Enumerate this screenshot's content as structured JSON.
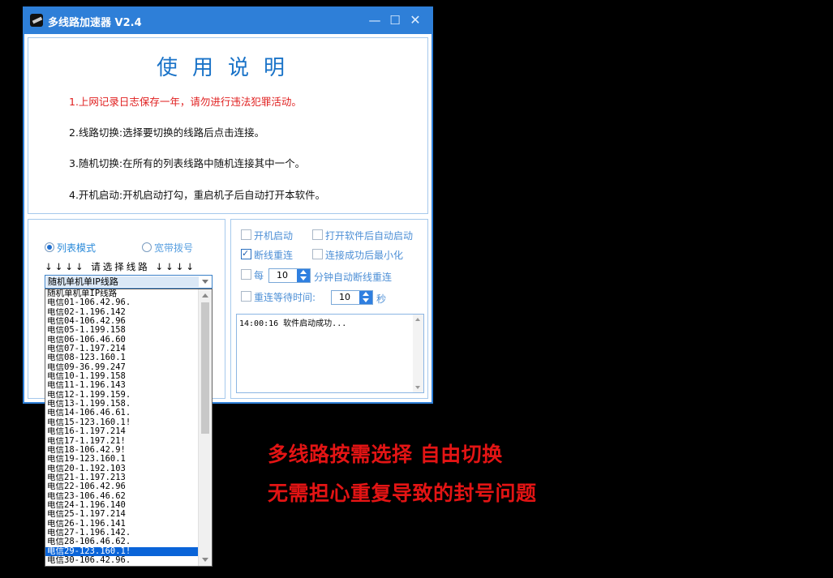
{
  "window": {
    "title": "多线路加速器 V2.4",
    "controls": {
      "minimize": "—",
      "maximize": "☐",
      "close": "✕"
    }
  },
  "instructions": {
    "heading": "使用说明",
    "lines": [
      "1.上网记录日志保存一年，请勿进行违法犯罪活动。",
      "2.线路切换:选择要切换的线路后点击连接。",
      "3.随机切换:在所有的列表线路中随机连接其中一个。",
      "4.开机启动:开机启动打勾，重启机子后自动打开本软件。"
    ]
  },
  "mode": {
    "list_mode": {
      "label": "列表模式",
      "selected": true
    },
    "broadband": {
      "label": "宽带拨号",
      "selected": false
    },
    "select_hint": "↓↓↓↓ 请选择线路 ↓↓↓↓"
  },
  "route_select": {
    "selected": "随机单机单IP线路",
    "options": [
      "随机单机单IP线路",
      "电信01-106.42.96.",
      "电信02-1.196.142",
      "电信04-106.42.96",
      "电信05-1.199.158",
      "电信06-106.46.60",
      "电信07-1.197.214",
      "电信08-123.160.1",
      "电信09-36.99.247",
      "电信10-1.199.158",
      "电信11-1.196.143",
      "电信12-1.199.159.",
      "电信13-1.199.158.",
      "电信14-106.46.61.",
      "电信15-123.160.1!",
      "电信16-1.197.214",
      "电信17-1.197.21!",
      "电信18-106.42.9!",
      "电信19-123.160.1",
      "电信20-1.192.103",
      "电信21-1.197.213",
      "电信22-106.42.96",
      "电信23-106.46.62",
      "电信24-1.196.140",
      "电信25-1.197.214",
      "电信26-1.196.141",
      "电信27-1.196.142.",
      "电信28-106.46.62.",
      "电信29-123.160.1!",
      "电信30-106.42.96."
    ],
    "highlighted_index": 28
  },
  "options": {
    "autostart": {
      "label": "开机启动",
      "checked": false
    },
    "auto_start_on_open": {
      "label": "打开软件后自动启动",
      "checked": false
    },
    "reconnect": {
      "label": "断线重连",
      "checked": true
    },
    "minimize_on_connect": {
      "label": "连接成功后最小化",
      "checked": false
    },
    "every": {
      "label": "每",
      "checked": false,
      "value": "10",
      "unit": "分钟自动断线重连"
    },
    "wait": {
      "label": "重连等待时间:",
      "checked": false,
      "value": "10",
      "unit": "秒"
    }
  },
  "log": {
    "text": "14:00:16 软件启动成功..."
  },
  "promo": {
    "line1": "多线路按需选择 自由切换",
    "line2": "无需担心重复导致的封号问题"
  },
  "colors": {
    "titlebar": "#2e7fd8",
    "accent": "#1a73c8",
    "warning": "#e02020",
    "promo": "#e31414",
    "highlight": "#0a64d8"
  }
}
